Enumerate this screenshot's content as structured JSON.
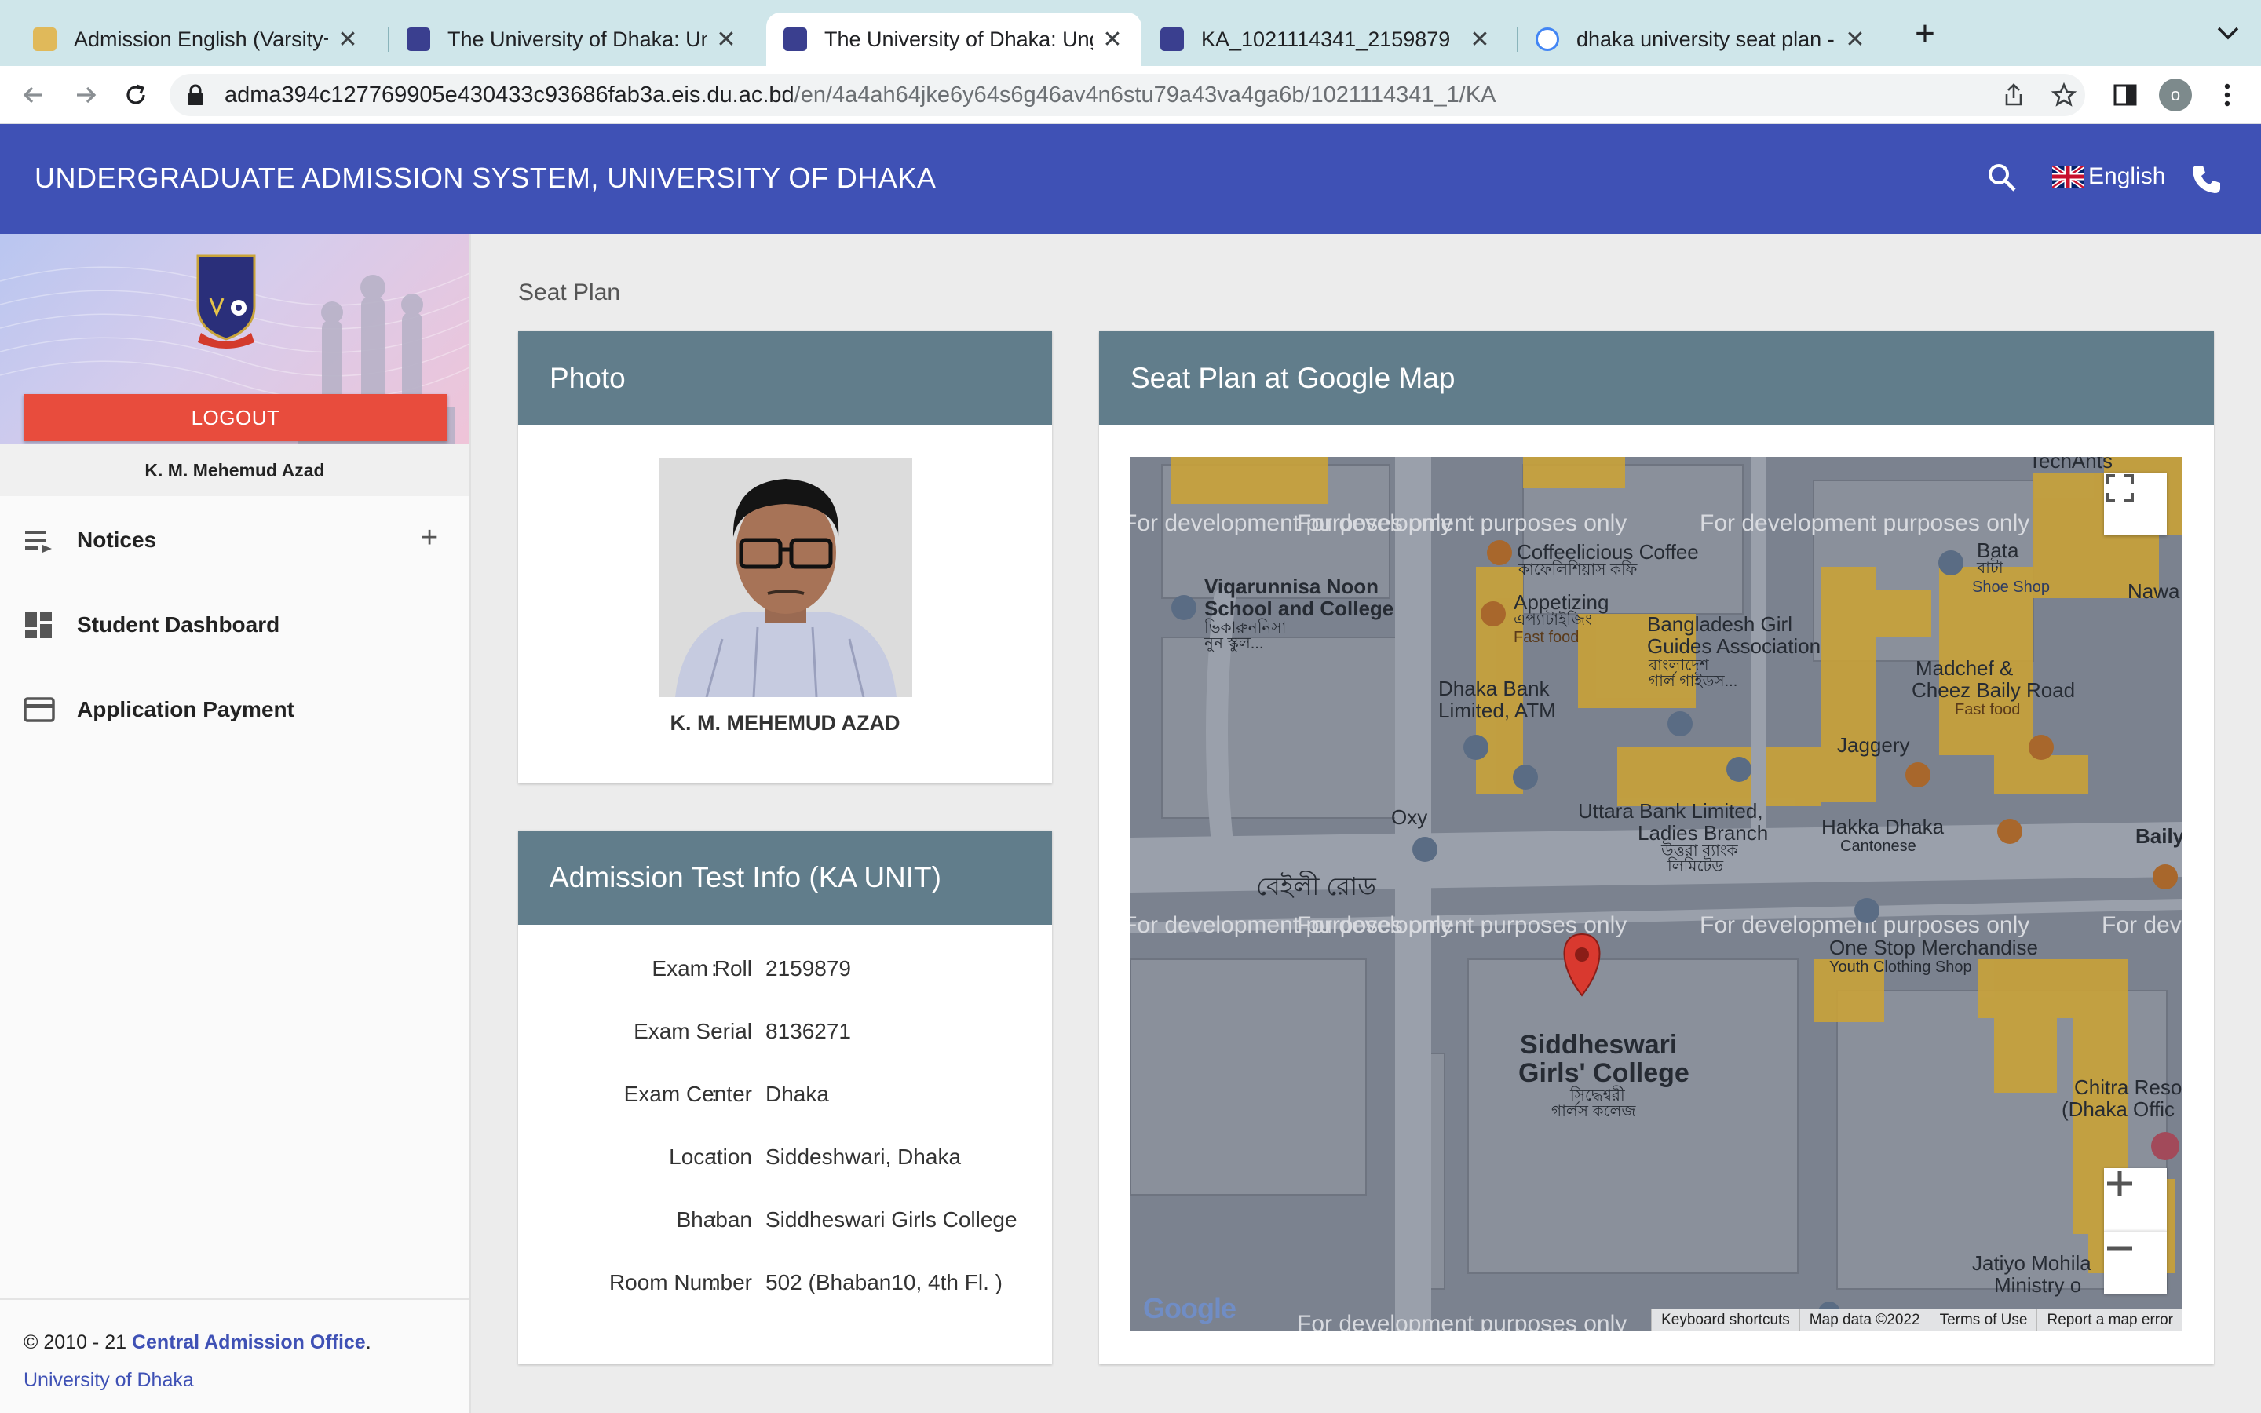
{
  "browser": {
    "tabs": [
      {
        "title": "Admission English (Varsity+Me",
        "active": false
      },
      {
        "title": "The University of Dhaka: Unge",
        "active": false
      },
      {
        "title": "The University of Dhaka: Unge",
        "active": true
      },
      {
        "title": "KA_1021114341_2159879",
        "active": false
      },
      {
        "title": "dhaka university seat plan - Go",
        "active": false
      }
    ],
    "url_host": "adma394c127769905e430433c93686fab3a.eis.du.ac.bd",
    "url_path": "/en/4a4ah64jke6y64s6g46av4n6stu79a43va4ga6b/1021114341_1/KA",
    "profile_initial": "o"
  },
  "header": {
    "title": "UNDERGRADUATE ADMISSION SYSTEM, UNIVERSITY OF DHAKA",
    "language": "English",
    "bg_color": "#3f51b5"
  },
  "sidebar": {
    "logout_label": "LOGOUT",
    "user_name": "K. M. Mehemud Azad",
    "menu": [
      {
        "label": "Notices",
        "icon": "notices-list-icon",
        "expandable": true
      },
      {
        "label": "Student Dashboard",
        "icon": "dashboard-icon",
        "expandable": false
      },
      {
        "label": "Application Payment",
        "icon": "credit-card-icon",
        "expandable": false
      }
    ],
    "footer": {
      "copyright": "© 2010 - 21",
      "office": "Central Admission Office",
      "period": ".",
      "university": "University of Dhaka"
    }
  },
  "main": {
    "breadcrumb": "Seat Plan",
    "photo_card": {
      "title": "Photo",
      "name": "K. M. MEHEMUD AZAD"
    },
    "info_card": {
      "title": "Admission Test Info (KA UNIT)",
      "rows": [
        {
          "label": "Exam Roll",
          "value": "2159879"
        },
        {
          "label": "Exam Serial",
          "value": "8136271"
        },
        {
          "label": "Exam Center",
          "value": "Dhaka"
        },
        {
          "label": "Location",
          "value": "Siddeshwari, Dhaka"
        },
        {
          "label": "Bhaban",
          "value": "Siddheswari Girls College"
        },
        {
          "label": "Room Number",
          "value": "502 (Bhaban10, 4th Fl. )"
        }
      ]
    },
    "map_card": {
      "title": "Seat Plan at Google Map",
      "watermark": "For development purposes only",
      "labels": {
        "techants": "TechAnts",
        "coffee": "Coffeelicious Coffee",
        "coffee_bn": "কাফেলিশিয়াস কফি",
        "bata": "Bata",
        "bata_bn": "বাটা",
        "bata_sub": "Shoe Shop",
        "nawa": "Nawa",
        "school1": "Viqarunnisa Noon",
        "school2": "School and College",
        "school_bn1": "ভিকারুননিসা",
        "school_bn2": "নুন স্কুল...",
        "appetizing": "Appetizing",
        "appetizing_bn": "এপ্যাটাইজিং",
        "appetizing_sub": "Fast food",
        "guides1": "Bangladesh Girl",
        "guides2": "Guides Association",
        "guides_bn1": "বাংলাদেশ",
        "guides_bn2": "গার্ল গাইডস...",
        "madchef1": "Madchef &",
        "madchef2": "Cheez Baily Road",
        "madchef_sub": "Fast food",
        "dhakabank1": "Dhaka Bank",
        "dhakabank2": "Limited, ATM",
        "jaggery": "Jaggery",
        "oxy": "Oxy",
        "uttara1": "Uttara Bank Limited,",
        "uttara2": "Ladies Branch",
        "uttara_bn1": "উত্তরা ব্যাংক",
        "uttara_bn2": "লিমিটেড",
        "hakka": "Hakka Dhaka",
        "hakka_sub": "Cantonese",
        "baily": "Baily",
        "road_bn": "বেইলী রোড",
        "onestop": "One Stop Merchandise",
        "onestop_sub": "Youth Clothing Shop",
        "college1": "Siddheswari",
        "college2": "Girls' College",
        "college_bn1": "সিদ্ধেশ্বরী",
        "college_bn2": "গার্লস কলেজ",
        "chitra1": "Chitra Reso",
        "chitra2": "(Dhaka Offic",
        "jatiyo1": "Jatiyo Mohila",
        "jatiyo2": "Ministry o",
        "google": "Google"
      },
      "footer": [
        "Keyboard shortcuts",
        "Map data ©2022",
        "Terms of Use",
        "Report a map error"
      ]
    }
  }
}
